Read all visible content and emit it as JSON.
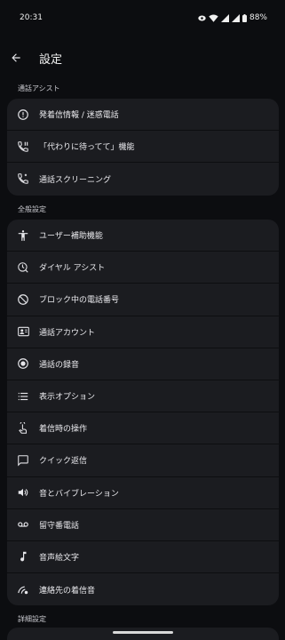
{
  "status_bar": {
    "time": "20:31",
    "battery": "88%"
  },
  "header": {
    "title": "設定"
  },
  "sections": [
    {
      "title": "通話アシスト",
      "items": [
        {
          "label": "発着信情報 / 迷惑電話",
          "icon": "alert-circle-icon"
        },
        {
          "label": "「代わりに待ってて」機能",
          "icon": "phone-hold-icon"
        },
        {
          "label": "通話スクリーニング",
          "icon": "phone-screen-icon"
        }
      ]
    },
    {
      "title": "全般設定",
      "items": [
        {
          "label": "ユーザー補助機能",
          "icon": "accessibility-icon"
        },
        {
          "label": "ダイヤル アシスト",
          "icon": "dial-assist-icon"
        },
        {
          "label": "ブロック中の電話番号",
          "icon": "block-icon"
        },
        {
          "label": "通話アカウント",
          "icon": "contact-card-icon"
        },
        {
          "label": "通話の録音",
          "icon": "record-icon"
        },
        {
          "label": "表示オプション",
          "icon": "list-icon"
        },
        {
          "label": "着信時の操作",
          "icon": "gesture-icon"
        },
        {
          "label": "クイック返信",
          "icon": "message-icon"
        },
        {
          "label": "音とバイブレーション",
          "icon": "volume-icon"
        },
        {
          "label": "留守番電話",
          "icon": "voicemail-icon"
        },
        {
          "label": "音声絵文字",
          "icon": "music-note-icon"
        },
        {
          "label": "連絡先の着信音",
          "icon": "ringtone-icon"
        }
      ]
    },
    {
      "title": "詳細設定",
      "items": []
    }
  ]
}
